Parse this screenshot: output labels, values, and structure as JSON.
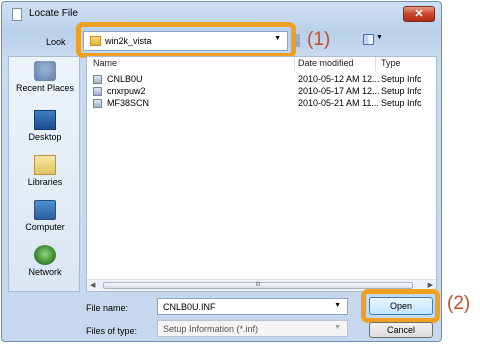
{
  "window": {
    "title": "Locate File",
    "close_label": "✕"
  },
  "toolbar": {
    "look_in_label": "Look",
    "look_in_value": "win2k_vista"
  },
  "callouts": {
    "one": "(1)",
    "two": "(2)"
  },
  "places": [
    {
      "label": "Recent Places",
      "icon": "recent-places-icon"
    },
    {
      "label": "Desktop",
      "icon": "desktop-icon"
    },
    {
      "label": "Libraries",
      "icon": "libraries-icon"
    },
    {
      "label": "Computer",
      "icon": "computer-icon"
    },
    {
      "label": "Network",
      "icon": "network-icon"
    }
  ],
  "filelist": {
    "columns": {
      "name": "Name",
      "date": "Date modified",
      "type": "Type"
    },
    "rows": [
      {
        "name": "CNLB0U",
        "date": "2010-05-12 AM 12...",
        "type": "Setup Infc"
      },
      {
        "name": "cnxrpuw2",
        "date": "2010-05-17 AM 12...",
        "type": "Setup Infc"
      },
      {
        "name": "MF38SCN",
        "date": "2010-05-21 AM 11...",
        "type": "Setup Infc"
      }
    ],
    "scroll_grip": "III"
  },
  "form": {
    "file_name_label": "File name:",
    "file_name_value": "CNLB0U.INF",
    "file_type_label": "Files of type:",
    "file_type_value": "Setup Information (*.inf)"
  },
  "buttons": {
    "open": "Open",
    "cancel": "Cancel"
  }
}
